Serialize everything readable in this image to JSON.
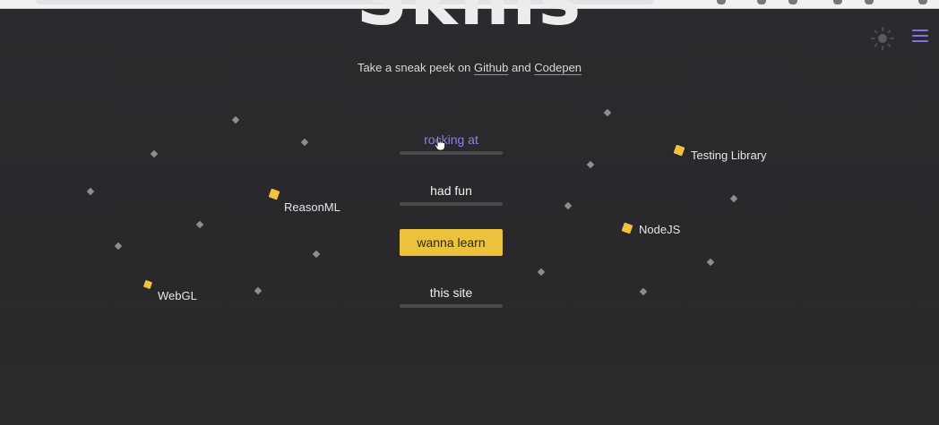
{
  "page": {
    "title": "Skills",
    "subtitle_prefix": "Take a sneak peek on ",
    "subtitle_link1": "Github",
    "subtitle_and": " and ",
    "subtitle_link2": "Codepen"
  },
  "menu": {
    "items": [
      {
        "label": "rocking at",
        "state": "hover"
      },
      {
        "label": "had fun",
        "state": "default"
      },
      {
        "label": "wanna learn",
        "state": "active"
      },
      {
        "label": "this site",
        "state": "default"
      }
    ]
  },
  "skills": [
    {
      "label": "ReasonML"
    },
    {
      "label": "WebGL"
    },
    {
      "label": "Testing Library"
    },
    {
      "label": "NodeJS"
    }
  ],
  "icons": {
    "theme_toggle": "sun-icon",
    "menu": "hamburger-menu-icon",
    "cursor": "hand-pointer-icon"
  },
  "colors": {
    "background": "#2b2a2e",
    "accent": "#ecc13c",
    "link_underline": "#8f85d8",
    "hover_text": "#8d82e6",
    "menu_icon": "#7f72e6",
    "dot": "#8e8e8e"
  }
}
